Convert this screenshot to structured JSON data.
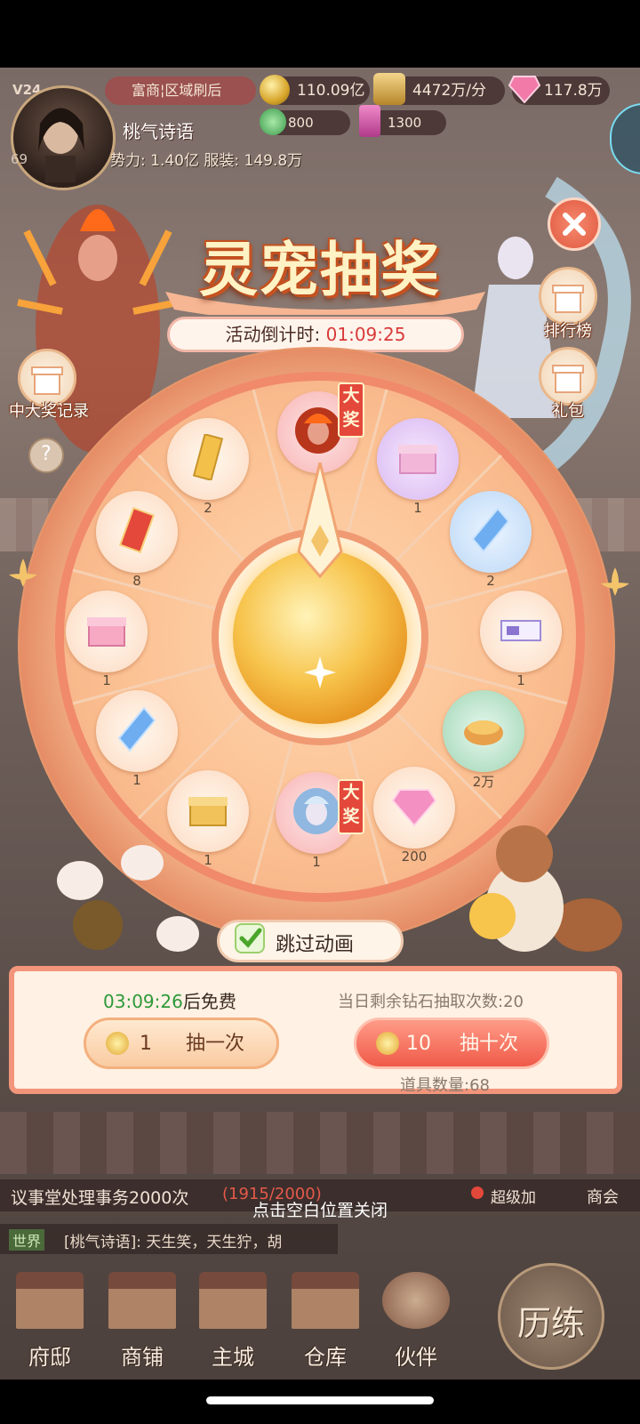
{
  "hud": {
    "version": "V24",
    "ranking_banner": "富商¦区域刷后",
    "player_name": "桃气诗语",
    "power_text": "势力: 1.40亿 服装: 149.8万",
    "level_partial": "69",
    "gold": "110.09亿",
    "income": "4472万/分",
    "gems": "117.8万",
    "jade": "800",
    "tickets": "1300"
  },
  "event": {
    "title": "灵宠抽奖",
    "countdown_label": "活动倒计时:",
    "countdown_time": "01:09:25"
  },
  "side_buttons": {
    "left_record": "中大奖记录",
    "right_ranking": "排行榜",
    "right_gift": "礼包",
    "help": "?"
  },
  "wheel": {
    "grand_tag": "大奖",
    "slots": [
      {
        "id": "top-pet-red",
        "count": "",
        "grand": true
      },
      {
        "id": "purple-chest",
        "count": "1"
      },
      {
        "id": "blue-crystal-a",
        "count": "2"
      },
      {
        "id": "ticket-purple",
        "count": "1"
      },
      {
        "id": "green-bowl",
        "count": "2万"
      },
      {
        "id": "diamond",
        "count": "200"
      },
      {
        "id": "bottom-pet-blue",
        "count": "1",
        "grand": true
      },
      {
        "id": "gold-chest",
        "count": "1"
      },
      {
        "id": "blue-crystal-b",
        "count": "1"
      },
      {
        "id": "pink-chest",
        "count": "1"
      },
      {
        "id": "red-envelope",
        "count": "8"
      },
      {
        "id": "gold-ticket",
        "count": "2"
      }
    ]
  },
  "controls": {
    "skip_animation": "跳过动画",
    "free_timer": "03:09:26",
    "free_suffix": "后免费",
    "remaining_label": "当日剩余钻石抽取次数:",
    "remaining_count": "20",
    "draw_one_cost": "1",
    "draw_one_label": "抽一次",
    "draw_ten_cost": "10",
    "draw_ten_label": "抽十次",
    "item_count_label": "道具数量:",
    "item_count": "68"
  },
  "bottom": {
    "quest_text": "议事堂处理事务2000次",
    "quest_progress": "(1915/2000)",
    "super_label": "超级加",
    "guild_label": "商会",
    "close_hint": "点击空白位置关闭",
    "chat_channel": "世界",
    "chat_text": "[桃气诗语]: 天生笑，天生狞，胡",
    "nav": [
      "府邸",
      "商铺",
      "主城",
      "仓库",
      "伙伴"
    ],
    "training": "历练"
  },
  "colors": {
    "accent_red": "#e4483a",
    "wheel_orange": "#f08a6a",
    "countdown_red": "#d83a3a",
    "free_timer_green": "#2d9a3a"
  }
}
